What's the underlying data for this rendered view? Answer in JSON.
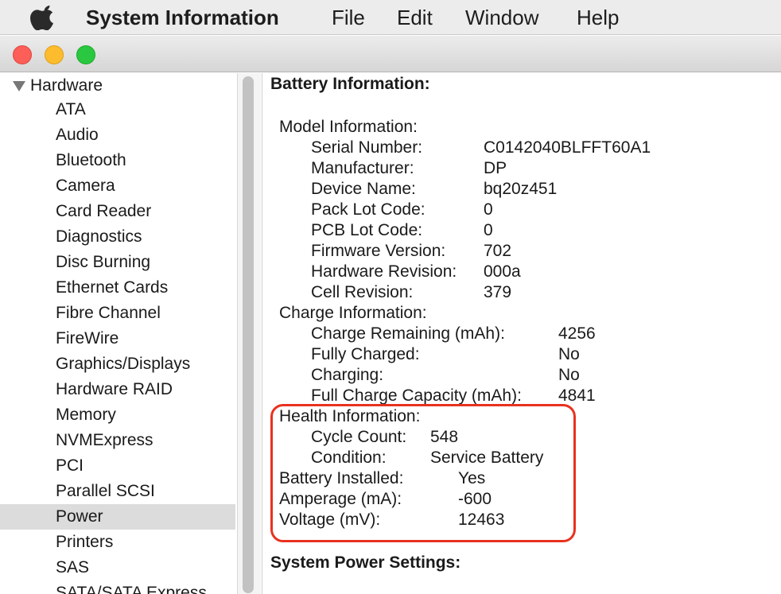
{
  "menubar": {
    "apple_icon": "apple-logo-icon",
    "app_name": "System Information",
    "items": [
      "File",
      "Edit",
      "Window",
      "Help"
    ]
  },
  "window_controls": [
    "close",
    "minimize",
    "maximize"
  ],
  "sidebar": {
    "section_label": "Hardware",
    "items": [
      "ATA",
      "Audio",
      "Bluetooth",
      "Camera",
      "Card Reader",
      "Diagnostics",
      "Disc Burning",
      "Ethernet Cards",
      "Fibre Channel",
      "FireWire",
      "Graphics/Displays",
      "Hardware RAID",
      "Memory",
      "NVMExpress",
      "PCI",
      "Parallel SCSI",
      "Power",
      "Printers",
      "SAS",
      "SATA/SATA Express"
    ],
    "selected": "Power"
  },
  "main": {
    "battery_heading": "Battery Information:",
    "model_info": {
      "label": "Model Information:",
      "fields": [
        {
          "k": "Serial Number:",
          "v": "C0142040BLFFT60A1"
        },
        {
          "k": "Manufacturer:",
          "v": "DP"
        },
        {
          "k": "Device Name:",
          "v": "bq20z451"
        },
        {
          "k": "Pack Lot Code:",
          "v": "0"
        },
        {
          "k": "PCB Lot Code:",
          "v": "0"
        },
        {
          "k": "Firmware Version:",
          "v": "702"
        },
        {
          "k": "Hardware Revision:",
          "v": "000a"
        },
        {
          "k": "Cell Revision:",
          "v": "379"
        }
      ]
    },
    "charge_info": {
      "label": "Charge Information:",
      "fields": [
        {
          "k": "Charge Remaining (mAh):",
          "v": "4256"
        },
        {
          "k": "Fully Charged:",
          "v": "No"
        },
        {
          "k": "Charging:",
          "v": "No"
        },
        {
          "k": "Full Charge Capacity (mAh):",
          "v": "4841"
        }
      ]
    },
    "health_info": {
      "label": "Health Information:",
      "fields": [
        {
          "k": "Cycle Count:",
          "v": "548"
        },
        {
          "k": "Condition:",
          "v": "Service Battery"
        }
      ]
    },
    "battery_fields": [
      {
        "k": "Battery Installed:",
        "v": "Yes"
      },
      {
        "k": "Amperage (mA):",
        "v": "-600"
      },
      {
        "k": "Voltage (mV):",
        "v": "12463"
      }
    ],
    "system_power_heading": "System Power Settings:"
  },
  "colors": {
    "highlight_border": "#e8321f",
    "selected_row": "#dcdcdc",
    "close": "#fc5f57",
    "minimize": "#fdbc2e",
    "maximize": "#29c840"
  }
}
